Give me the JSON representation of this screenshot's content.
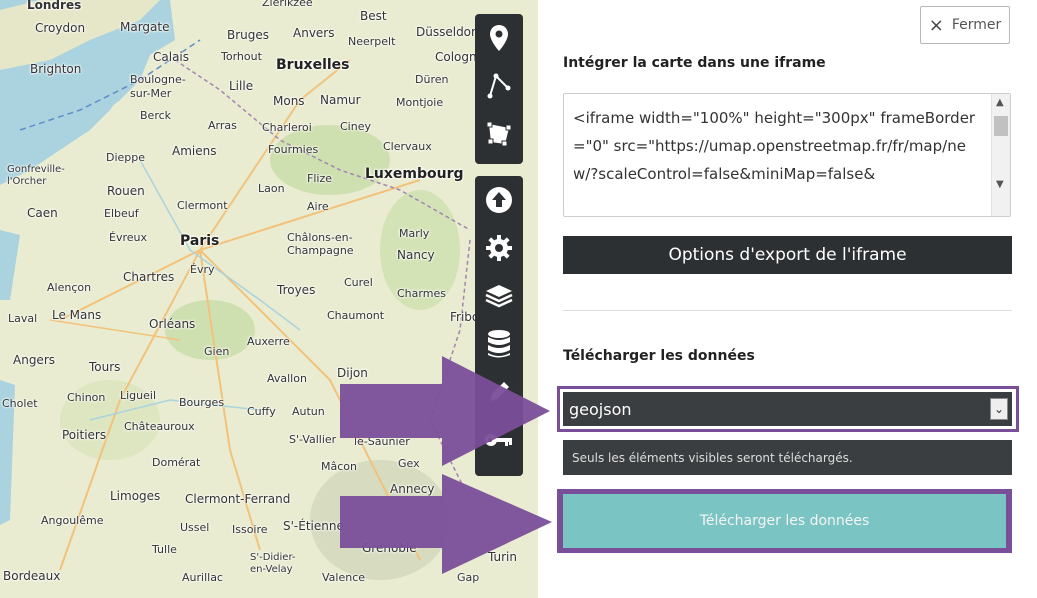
{
  "map": {
    "cities": [
      {
        "name": "Londres",
        "big": false
      },
      {
        "name": "Croydon",
        "big": false
      },
      {
        "name": "Brighton",
        "big": false
      },
      {
        "name": "Margate",
        "big": false
      },
      {
        "name": "Calais",
        "big": false
      },
      {
        "name": "Bruges",
        "big": false
      },
      {
        "name": "Anvers",
        "big": false
      },
      {
        "name": "Best",
        "big": false
      },
      {
        "name": "Zierikzee",
        "big": false
      },
      {
        "name": "Düsseldorf",
        "big": false
      },
      {
        "name": "Cologne",
        "big": false
      },
      {
        "name": "Bruxelles",
        "big": true
      },
      {
        "name": "Torhout",
        "big": false
      },
      {
        "name": "Neerpelt",
        "big": false
      },
      {
        "name": "Düren",
        "big": false
      },
      {
        "name": "Boulogne-sur-Mer",
        "big": false
      },
      {
        "name": "Lille",
        "big": false
      },
      {
        "name": "Mons",
        "big": false
      },
      {
        "name": "Namur",
        "big": false
      },
      {
        "name": "Montjoie",
        "big": false
      },
      {
        "name": "Berck",
        "big": false
      },
      {
        "name": "Arras",
        "big": false
      },
      {
        "name": "Charleroi",
        "big": false
      },
      {
        "name": "Ciney",
        "big": false
      },
      {
        "name": "Amiens",
        "big": false
      },
      {
        "name": "Fourmies",
        "big": false
      },
      {
        "name": "Clervaux",
        "big": false
      },
      {
        "name": "Dieppe",
        "big": false
      },
      {
        "name": "Gonfreville-l'Orcher",
        "big": false
      },
      {
        "name": "Luxembourg",
        "big": true
      },
      {
        "name": "Rouen",
        "big": false
      },
      {
        "name": "Laon",
        "big": false
      },
      {
        "name": "Flize",
        "big": false
      },
      {
        "name": "Caen",
        "big": false
      },
      {
        "name": "Elbeuf",
        "big": false
      },
      {
        "name": "Clermont",
        "big": false
      },
      {
        "name": "Aire",
        "big": false
      },
      {
        "name": "Évreux",
        "big": false
      },
      {
        "name": "Paris",
        "big": true
      },
      {
        "name": "Châlons-en-Champagne",
        "big": false
      },
      {
        "name": "Marly",
        "big": false
      },
      {
        "name": "Nancy",
        "big": false
      },
      {
        "name": "Chartres",
        "big": false
      },
      {
        "name": "Évry",
        "big": false
      },
      {
        "name": "Alençon",
        "big": false
      },
      {
        "name": "Troyes",
        "big": false
      },
      {
        "name": "Curel",
        "big": false
      },
      {
        "name": "Charmes",
        "big": false
      },
      {
        "name": "Laval",
        "big": false
      },
      {
        "name": "Le Mans",
        "big": false
      },
      {
        "name": "Orléans",
        "big": false
      },
      {
        "name": "Chaumont",
        "big": false
      },
      {
        "name": "Fribo",
        "big": false
      },
      {
        "name": "Auxerre",
        "big": false
      },
      {
        "name": "Angers",
        "big": false
      },
      {
        "name": "Gien",
        "big": false
      },
      {
        "name": "Tours",
        "big": false
      },
      {
        "name": "Avallon",
        "big": false
      },
      {
        "name": "Dijon",
        "big": false
      },
      {
        "name": "Cholet",
        "big": false
      },
      {
        "name": "Chinon",
        "big": false
      },
      {
        "name": "Ligueil",
        "big": false
      },
      {
        "name": "Bourges",
        "big": false
      },
      {
        "name": "Cuffy",
        "big": false
      },
      {
        "name": "Autun",
        "big": false
      },
      {
        "name": "Poitiers",
        "big": false
      },
      {
        "name": "Châteauroux",
        "big": false
      },
      {
        "name": "S'-Vallier",
        "big": false
      },
      {
        "name": "le-Saunier",
        "big": false
      },
      {
        "name": "Domérat",
        "big": false
      },
      {
        "name": "Mâcon",
        "big": false
      },
      {
        "name": "Gex",
        "big": false
      },
      {
        "name": "Limoges",
        "big": false
      },
      {
        "name": "Clermont-Ferrand",
        "big": false
      },
      {
        "name": "Annecy",
        "big": false
      },
      {
        "name": "Angoulême",
        "big": false
      },
      {
        "name": "Ussel",
        "big": false
      },
      {
        "name": "Issoire",
        "big": false
      },
      {
        "name": "S'-Étienne",
        "big": false
      },
      {
        "name": "Tulle",
        "big": false
      },
      {
        "name": "S'-Didier-en-Velay",
        "big": false
      },
      {
        "name": "Grenoble",
        "big": false
      },
      {
        "name": "Turin",
        "big": false
      },
      {
        "name": "Bordeaux",
        "big": false
      },
      {
        "name": "Aurillac",
        "big": false
      },
      {
        "name": "Valence",
        "big": false
      },
      {
        "name": "Gap",
        "big": false
      }
    ],
    "toolbar_top": [
      {
        "icon": "marker-icon"
      },
      {
        "icon": "polyline-icon"
      },
      {
        "icon": "polygon-icon"
      }
    ],
    "toolbar_bottom": [
      {
        "icon": "upload-icon"
      },
      {
        "icon": "gear-icon"
      },
      {
        "icon": "layers-icon"
      },
      {
        "icon": "database-icon"
      },
      {
        "icon": "pencil-icon"
      },
      {
        "icon": "key-icon"
      }
    ]
  },
  "panel": {
    "close_label": "Fermer",
    "iframe_heading": "Intégrer la carte dans une iframe",
    "iframe_code": "<iframe width=\"100%\" height=\"300px\" frameBorder=\"0\" src=\"https://umap.openstreetmap.fr/fr/map/new/?scaleControl=false&miniMap=false&",
    "iframe_options_label": "Options d'export de l'iframe",
    "download_heading": "Télécharger les données",
    "format_selected": "geojson",
    "hint": "Seuls les éléments visibles seront téléchargés.",
    "download_button": "Télécharger les données"
  },
  "colors": {
    "toolbar": "#2d3032",
    "highlight": "#7a4f9a",
    "download_button": "#7bc4c4"
  }
}
